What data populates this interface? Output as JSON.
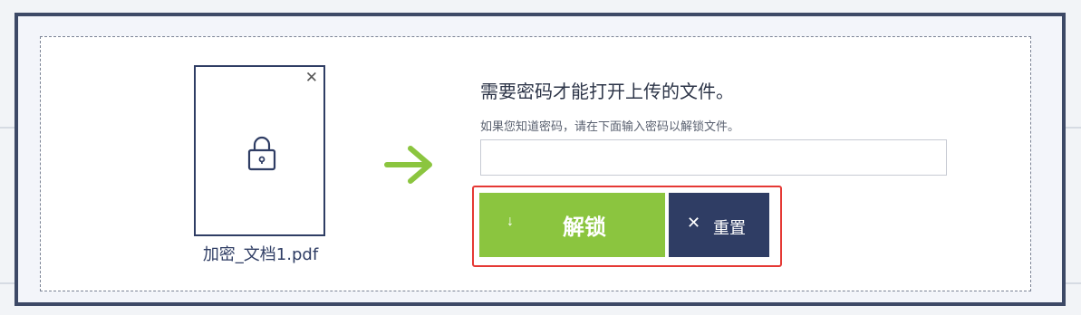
{
  "file": {
    "name": "加密_文档1.pdf",
    "close_icon": "close-icon",
    "lock_icon": "lock-icon"
  },
  "arrow_icon": "arrow-right-icon",
  "unlock_panel": {
    "headline": "需要密码才能打开上传的文件。",
    "hint": "如果您知道密码，请在下面输入密码以解锁文件。",
    "password_value": "",
    "password_placeholder": ""
  },
  "buttons": {
    "unlock": {
      "icon": "↓",
      "label": "解锁"
    },
    "reset": {
      "icon": "✕",
      "label": "重置"
    }
  },
  "colors": {
    "accent_green": "#8bc53f",
    "navy": "#2f3d64",
    "highlight_red": "#e53935"
  }
}
